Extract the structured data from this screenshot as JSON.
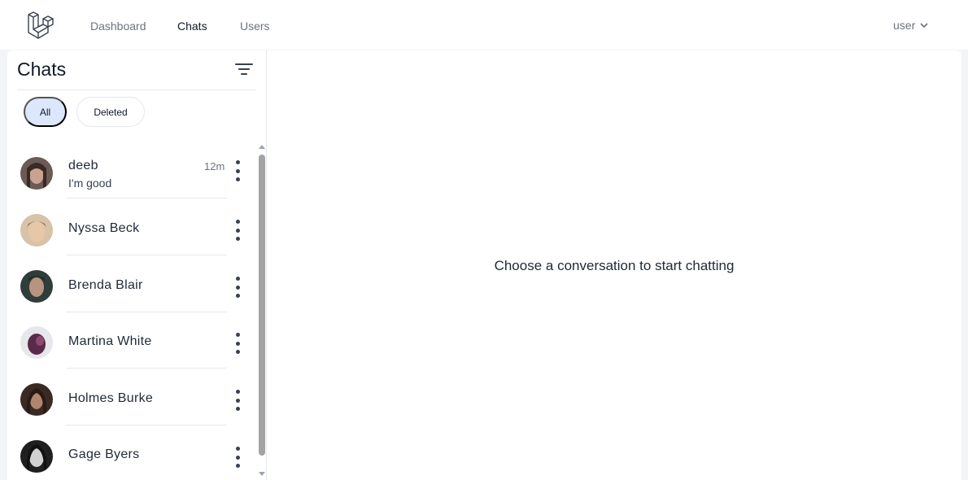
{
  "nav": {
    "links": [
      {
        "label": "Dashboard"
      },
      {
        "label": "Chats"
      },
      {
        "label": "Users"
      }
    ],
    "active": "Chats",
    "user_label": "user"
  },
  "sidebar": {
    "title": "Chats",
    "filters": [
      {
        "label": "All",
        "selected": true
      },
      {
        "label": "Deleted",
        "selected": false
      }
    ],
    "chats": [
      {
        "name": "deeb",
        "preview": "I'm good",
        "time": "12m"
      },
      {
        "name": "Nyssa Beck",
        "preview": "",
        "time": ""
      },
      {
        "name": "Brenda Blair",
        "preview": "",
        "time": ""
      },
      {
        "name": "Martina White",
        "preview": "",
        "time": ""
      },
      {
        "name": "Holmes Burke",
        "preview": "",
        "time": ""
      },
      {
        "name": "Gage Byers",
        "preview": "",
        "time": ""
      }
    ]
  },
  "main": {
    "empty_message": "Choose a conversation to start chatting"
  },
  "colors": {
    "accent_pill": "#dbe7fb",
    "background": "#f3f4f6",
    "text": "#111827"
  }
}
